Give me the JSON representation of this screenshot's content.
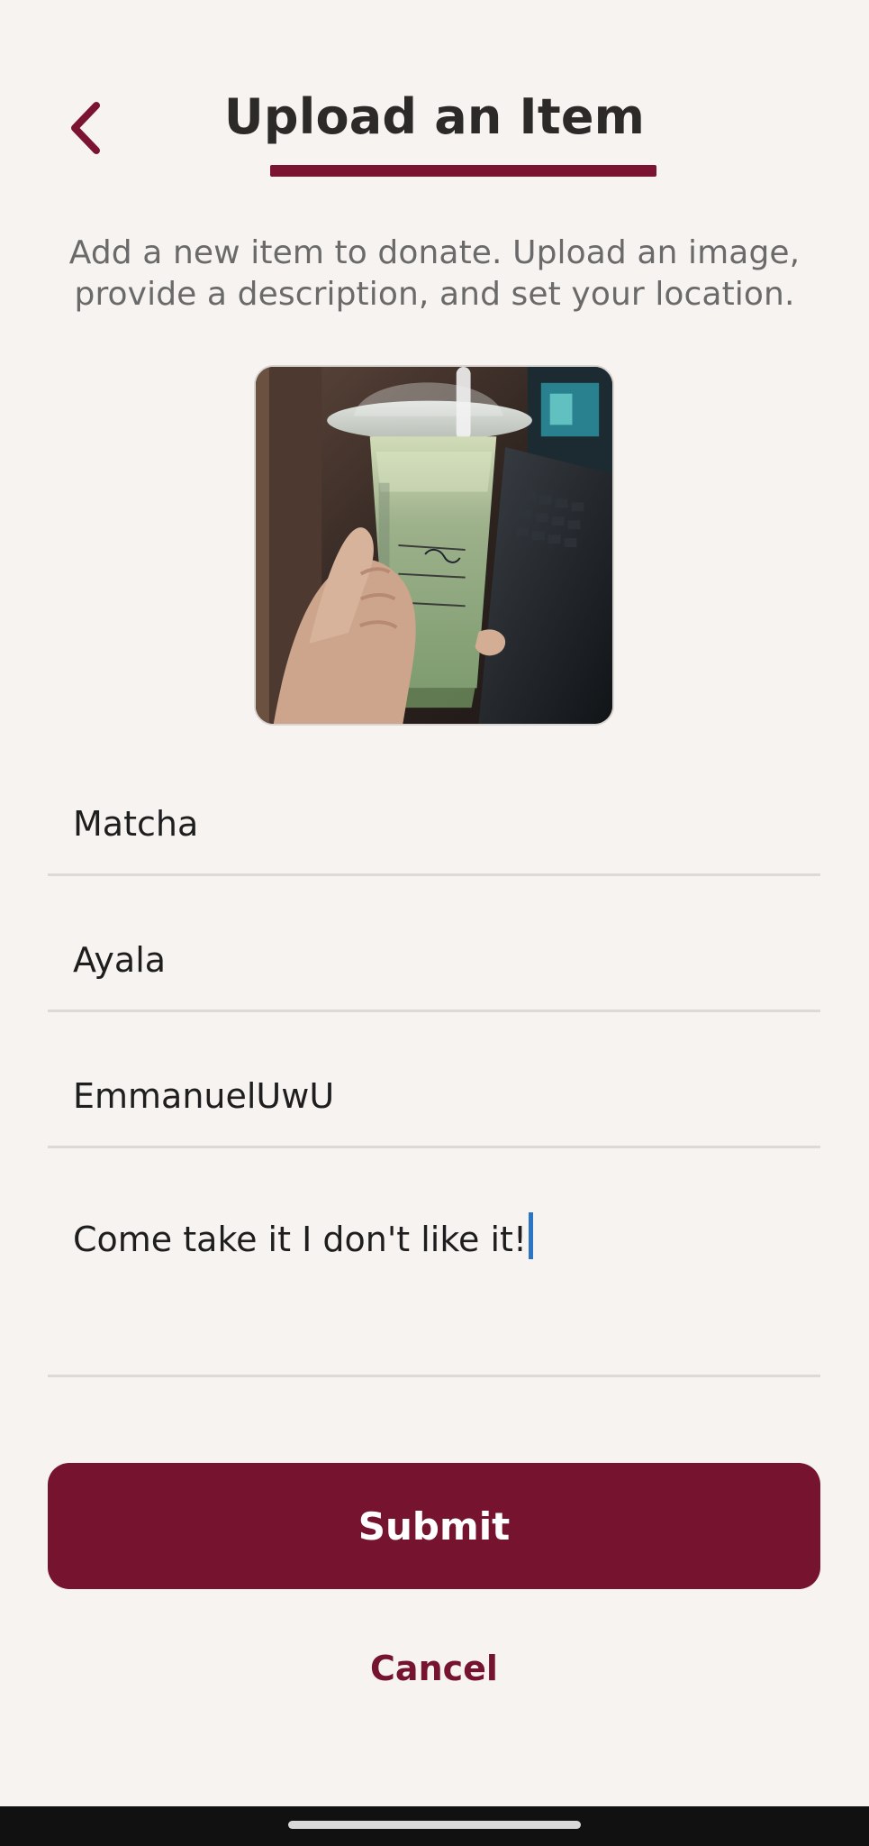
{
  "header": {
    "back_icon": "chevron-left-icon",
    "title": "Upload an Item"
  },
  "intro": {
    "text": "Add a new item to donate. Upload an image, provide a description, and set your location."
  },
  "image_preview": {
    "icon": "uploaded-photo"
  },
  "form": {
    "item_name": "Matcha",
    "location": "Ayala",
    "username": "EmmanuelUwU",
    "description": "Come take it I don't like it!"
  },
  "actions": {
    "submit_label": "Submit",
    "cancel_label": "Cancel"
  },
  "colors": {
    "background": "#f7f3f1",
    "accent": "#76132f",
    "divider": "#ddd9d6",
    "text": "#1e1e1e",
    "muted_text": "#6a6a6a",
    "cursor": "#2c74c4"
  }
}
